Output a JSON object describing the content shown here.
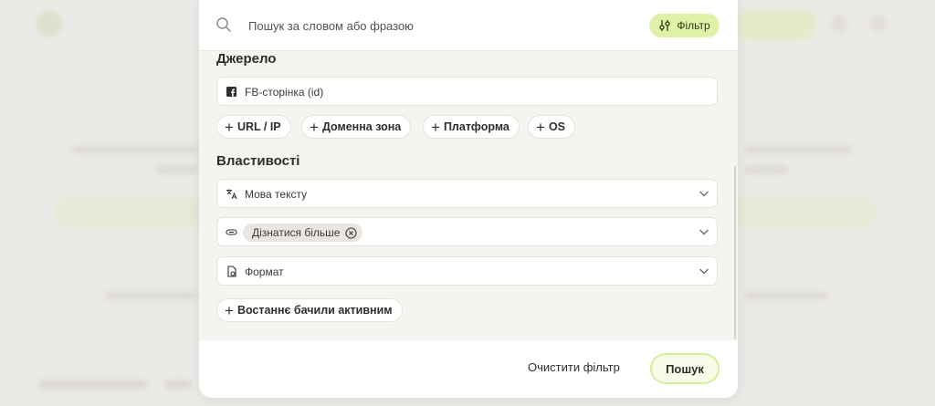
{
  "search": {
    "placeholder": "Пошук за словом або фразою",
    "value": ""
  },
  "filter_button": {
    "label": "Фільтр"
  },
  "source": {
    "title": "Джерело",
    "fb_field": {
      "label": "FB-сторінка (id)",
      "icon": "facebook-icon"
    },
    "add_buttons": [
      "URL / IP",
      "Доменна зона",
      "Платформа",
      "OS"
    ]
  },
  "properties": {
    "title": "Властивості",
    "language": {
      "label": "Мова тексту",
      "icon": "translate-icon"
    },
    "cta": {
      "tag": "Дізнатися більше",
      "icon": "link-icon"
    },
    "format": {
      "label": "Формат",
      "icon": "file-format-icon"
    },
    "last_seen_button": "Востаннє бачили активним"
  },
  "footer": {
    "clear_label": "Очистити фільтр",
    "submit_label": "Пошук"
  },
  "colors": {
    "accent_green": "#dff2a8",
    "panel_bg": "#f6f4f1"
  }
}
